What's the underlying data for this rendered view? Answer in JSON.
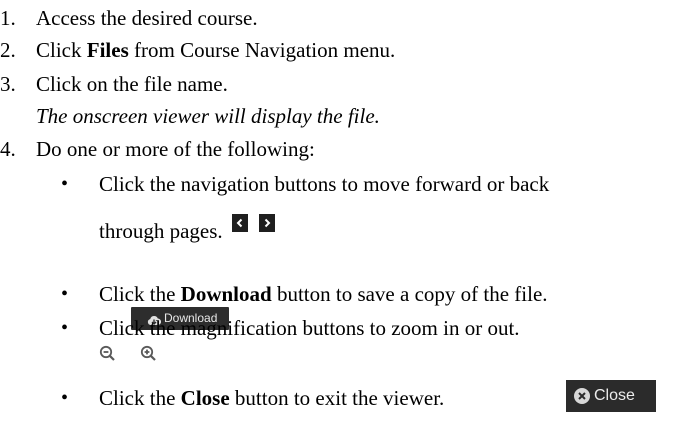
{
  "steps": [
    {
      "num": "1.",
      "text": "Access the desired course."
    },
    {
      "num": "2.",
      "pre": "Click ",
      "bold": "Files",
      "post": " from Course Navigation menu."
    },
    {
      "num": "3.",
      "text": "Click on the file name."
    },
    {
      "note": "The onscreen viewer will display the file."
    },
    {
      "num": "4.",
      "text": "Do one or more of the following:"
    }
  ],
  "bullets": {
    "b1_line1": "Click the navigation buttons to move forward or back",
    "b1_line2": "through pages.",
    "b2_pre": "Click the ",
    "b2_bold": "Download",
    "b2_post": " button to save a copy of the file.",
    "b3": "Click the magnification buttons to zoom in or out.",
    "b4_pre": "Click the ",
    "b4_bold": "Close",
    "b4_post": " button to exit the viewer."
  },
  "buttons": {
    "download_label": "Download",
    "close_label": "Close"
  },
  "icons": {
    "prev": "chevron-left-icon",
    "next": "chevron-right-icon",
    "cloud": "cloud-download-icon",
    "zoom_out": "zoom-out-icon",
    "zoom_in": "zoom-in-icon",
    "close": "close-circle-icon"
  },
  "colors": {
    "button_bg": "#2d2d2d",
    "icon_gray": "#5a5a5a"
  }
}
